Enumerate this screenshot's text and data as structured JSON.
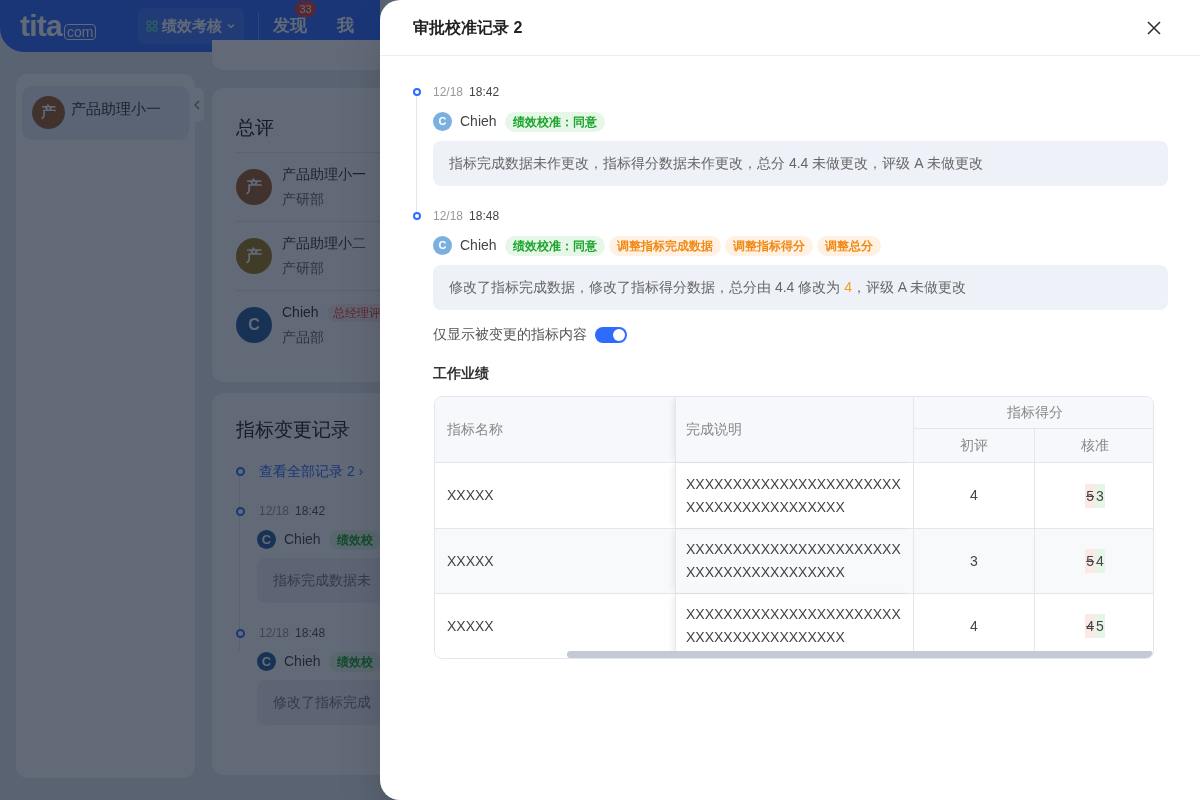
{
  "app": {
    "logo": "tita",
    "logo_suffix": "com"
  },
  "nav": [
    {
      "label": "绩效考核",
      "kind": "dropdown"
    },
    {
      "label": "发现",
      "kind": "link",
      "badge": "33"
    },
    {
      "label": "我",
      "kind": "link"
    }
  ],
  "sidebar": {
    "items": [
      {
        "avatar": "产",
        "name": "产品助理小一"
      }
    ]
  },
  "overall": {
    "title": "总评",
    "people": [
      {
        "avatar": "产",
        "name": "产品助理小一",
        "dept": "产研部"
      },
      {
        "avatar": "产",
        "name": "产品助理小二",
        "dept": "产研部"
      },
      {
        "avatar": "C",
        "name": "Chieh",
        "dept": "产品部",
        "tag": "总经理评"
      }
    ]
  },
  "changes": {
    "title": "指标变更记录",
    "link": "查看全部记录 2 ›",
    "entries": [
      {
        "date": "12/18",
        "time": "18:42",
        "avatar": "C",
        "user": "Chieh",
        "tag": "绩效校",
        "summary": "指标完成数据未"
      },
      {
        "date": "12/18",
        "time": "18:48",
        "avatar": "C",
        "user": "Chieh",
        "tag": "绩效校",
        "summary": "修改了指标完成"
      }
    ]
  },
  "drawer": {
    "title": "审批校准记录 2",
    "entries": [
      {
        "date": "12/18",
        "time": "18:42",
        "avatar": "C",
        "user": "Chieh",
        "tags": [
          {
            "label": "绩效校准：同意",
            "kind": "agree"
          }
        ],
        "summary": [
          {
            "text": "指标完成数据未作更改，指标得分数据未作更改，总分 4.4 未做更改，评级 A 未做更改",
            "highlight": false
          }
        ]
      },
      {
        "date": "12/18",
        "time": "18:48",
        "avatar": "C",
        "user": "Chieh",
        "tags": [
          {
            "label": "绩效校准：同意",
            "kind": "agree"
          },
          {
            "label": "调整指标完成数据",
            "kind": "adjust"
          },
          {
            "label": "调整指标得分",
            "kind": "adjust"
          },
          {
            "label": "调整总分",
            "kind": "adjust"
          }
        ],
        "summary": [
          {
            "text": "修改了指标完成数据，修改了指标得分数据，总分由 4.4 修改为 ",
            "highlight": false
          },
          {
            "text": "4",
            "highlight": true
          },
          {
            "text": "，评级 A 未做更改",
            "highlight": false
          }
        ]
      }
    ],
    "toggle": {
      "label": "仅显示被变更的指标内容",
      "on": true
    },
    "section": "工作业绩",
    "table": {
      "columns": [
        "指标名称",
        "完成说明"
      ],
      "group": "指标得分",
      "subcolumns": [
        "初评",
        "核准"
      ],
      "rows": [
        {
          "name": "XXXXX",
          "note": "XXXXXXXXXXXXXXXXXXXXXXXXXXXXXXXXXXXXXXXX",
          "initial": "4",
          "old": "5",
          "new": "3"
        },
        {
          "name": "XXXXX",
          "note": "XXXXXXXXXXXXXXXXXXXXXXXXXXXXXXXXXXXXXXXX",
          "initial": "3",
          "old": "5",
          "new": "4"
        },
        {
          "name": "XXXXX",
          "note": "XXXXXXXXXXXXXXXXXXXXXXXXXXXXXXXXXXXXXXXX",
          "initial": "4",
          "old": "4",
          "new": "5"
        }
      ]
    }
  }
}
